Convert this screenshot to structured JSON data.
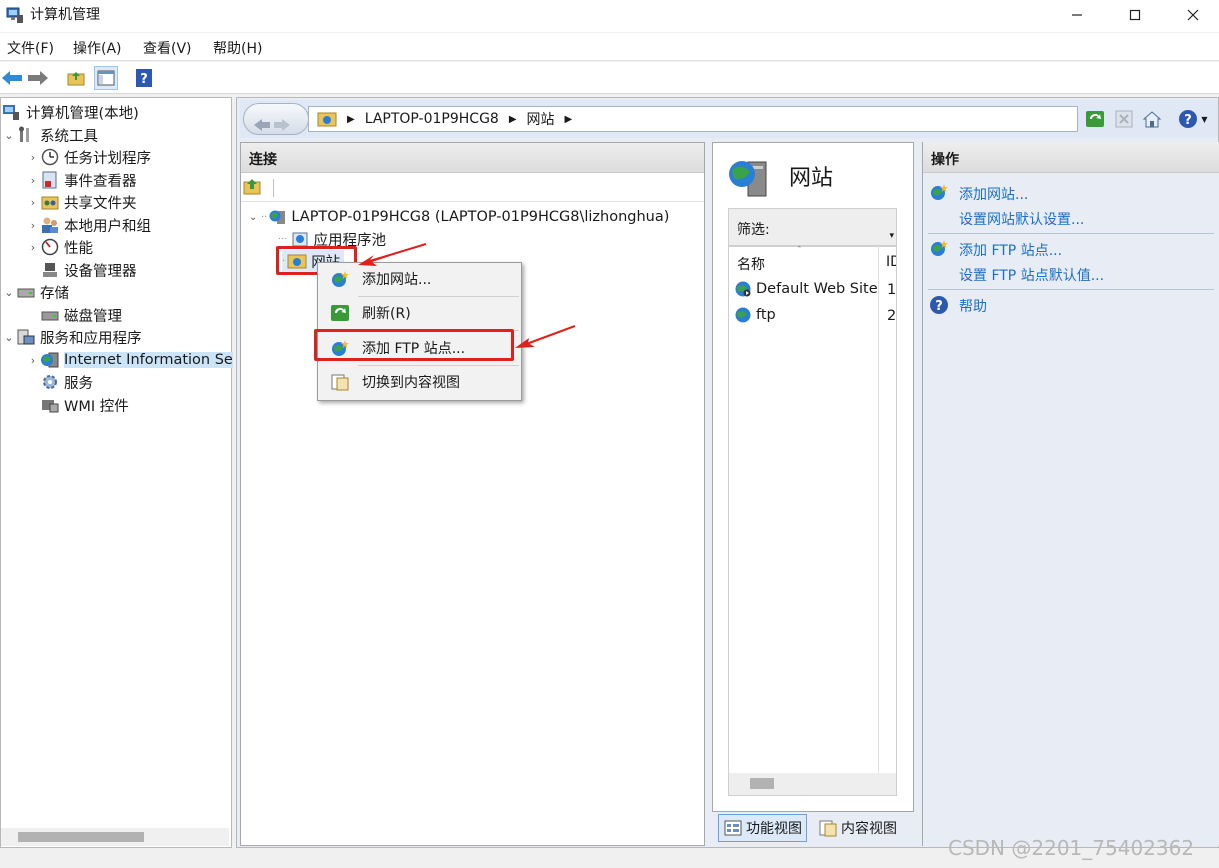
{
  "window": {
    "title": "计算机管理"
  },
  "menu": [
    "文件(F)",
    "操作(A)",
    "查看(V)",
    "帮助(H)"
  ],
  "tree": {
    "root": "计算机管理(本地)",
    "system_tools": "系统工具",
    "task_scheduler": "任务计划程序",
    "event_viewer": "事件查看器",
    "shared_folders": "共享文件夹",
    "local_users": "本地用户和组",
    "performance": "性能",
    "device_manager": "设备管理器",
    "storage": "存储",
    "disk_management": "磁盘管理",
    "services_apps": "服务和应用程序",
    "iis": "Internet Information Se",
    "services": "服务",
    "wmi": "WMI 控件"
  },
  "address": {
    "host": "LAPTOP-01P9HCG8",
    "node": "网站"
  },
  "connections": {
    "header": "连接",
    "server": "LAPTOP-01P9HCG8 (LAPTOP-01P9HCG8\\lizhonghua)",
    "app_pools": "应用程序池",
    "sites": "网站"
  },
  "context_menu": {
    "add_site": "添加网站...",
    "refresh": "刷新(R)",
    "add_ftp": "添加 FTP 站点...",
    "content_view": "切换到内容视图"
  },
  "features": {
    "title": "网站",
    "filter_label": "筛选:",
    "col_name": "名称",
    "col_id": "ID",
    "rows": [
      {
        "name": "Default Web Site",
        "id": "1"
      },
      {
        "name": "ftp",
        "id": "2"
      }
    ],
    "tab_features": "功能视图",
    "tab_content": "内容视图"
  },
  "actions": {
    "header": "操作",
    "add_site": "添加网站...",
    "site_defaults": "设置网站默认设置...",
    "add_ftp": "添加 FTP 站点...",
    "ftp_defaults": "设置 FTP 站点默认值...",
    "help": "帮助"
  },
  "watermark": "CSDN @2201_75402362",
  "colors": {
    "link": "#1c6ec8",
    "annotation": "#e0201d",
    "selection": "#cce4f7"
  }
}
